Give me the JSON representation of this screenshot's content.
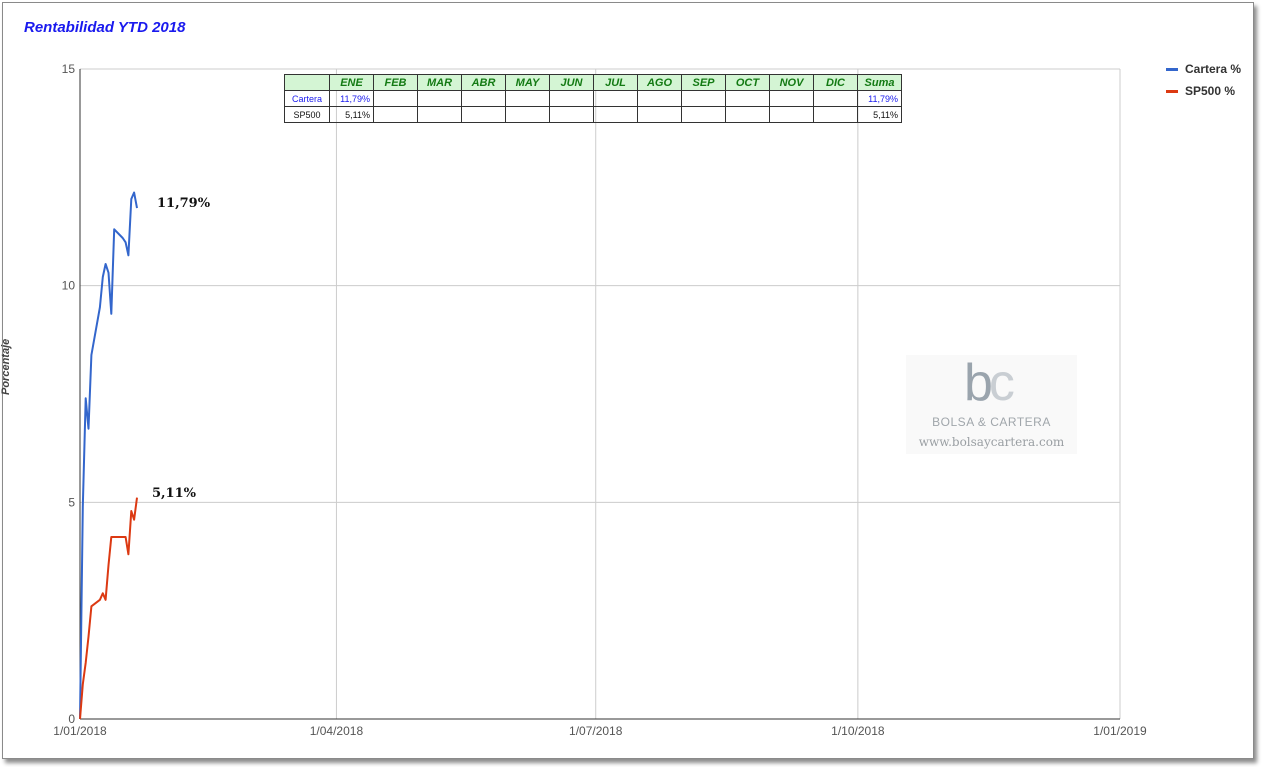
{
  "chart_data": {
    "type": "line",
    "title": "Rentabilidad YTD 2018",
    "ylabel": "Porcentaje",
    "xlabel": "",
    "ylim": [
      0,
      15
    ],
    "yticks": [
      "0",
      "5",
      "10",
      "15"
    ],
    "xlim": [
      "2018-01-01",
      "2019-01-01"
    ],
    "xticks": [
      "1/01/2018",
      "1/04/2018",
      "1/07/2018",
      "1/10/2018",
      "1/01/2019"
    ],
    "grid": true,
    "legend_position": "top-right",
    "series": [
      {
        "name": "Cartera %",
        "color": "#3366cc",
        "end_label": "11,79%",
        "points": [
          [
            "2018-01-01",
            0.0
          ],
          [
            "2018-01-02",
            4.9
          ],
          [
            "2018-01-03",
            7.4
          ],
          [
            "2018-01-04",
            6.7
          ],
          [
            "2018-01-05",
            8.4
          ],
          [
            "2018-01-08",
            9.5
          ],
          [
            "2018-01-09",
            10.2
          ],
          [
            "2018-01-10",
            10.5
          ],
          [
            "2018-01-11",
            10.3
          ],
          [
            "2018-01-12",
            9.35
          ],
          [
            "2018-01-13",
            11.3
          ],
          [
            "2018-01-16",
            11.1
          ],
          [
            "2018-01-17",
            11.0
          ],
          [
            "2018-01-18",
            10.7
          ],
          [
            "2018-01-19",
            12.0
          ],
          [
            "2018-01-20",
            12.15
          ],
          [
            "2018-01-21",
            11.79
          ]
        ]
      },
      {
        "name": "SP500 %",
        "color": "#dc3912",
        "end_label": "5,11%",
        "points": [
          [
            "2018-01-01",
            0.0
          ],
          [
            "2018-01-02",
            0.8
          ],
          [
            "2018-01-03",
            1.3
          ],
          [
            "2018-01-04",
            1.9
          ],
          [
            "2018-01-05",
            2.6
          ],
          [
            "2018-01-08",
            2.75
          ],
          [
            "2018-01-09",
            2.9
          ],
          [
            "2018-01-10",
            2.75
          ],
          [
            "2018-01-11",
            3.55
          ],
          [
            "2018-01-12",
            4.2
          ],
          [
            "2018-01-16",
            4.2
          ],
          [
            "2018-01-17",
            4.2
          ],
          [
            "2018-01-18",
            3.8
          ],
          [
            "2018-01-19",
            4.8
          ],
          [
            "2018-01-20",
            4.6
          ],
          [
            "2018-01-21",
            5.11
          ]
        ]
      }
    ],
    "table": {
      "headers": [
        "",
        "ENE",
        "FEB",
        "MAR",
        "ABR",
        "MAY",
        "JUN",
        "JUL",
        "AGO",
        "SEP",
        "OCT",
        "NOV",
        "DIC",
        "Suma"
      ],
      "rows": [
        [
          "Cartera",
          "11,79%",
          "",
          "",
          "",
          "",
          "",
          "",
          "",
          "",
          "",
          "",
          "",
          "11,79%"
        ],
        [
          "SP500",
          "5,11%",
          "",
          "",
          "",
          "",
          "",
          "",
          "",
          "",
          "",
          "",
          "",
          "5,11%"
        ]
      ]
    }
  },
  "watermark": {
    "logo_letters": "bc",
    "name": "BOLSA & CARTERA",
    "url": "www.bolsaycartera.com"
  }
}
